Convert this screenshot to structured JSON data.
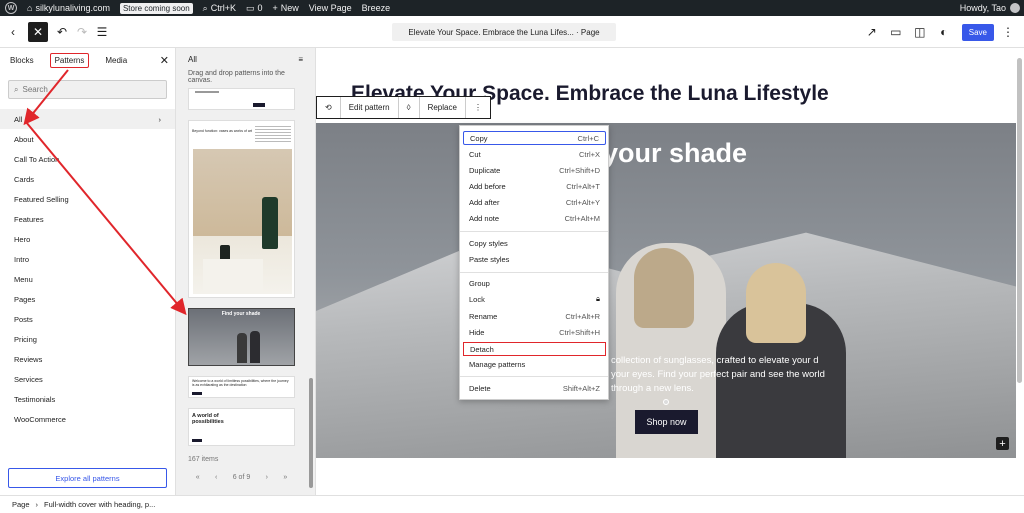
{
  "admin_bar": {
    "site": "silkylunaliving.com",
    "store_badge": "Store coming soon",
    "shortcut": "Ctrl+K",
    "comments_count": "0",
    "new_label": "New",
    "view_page": "View Page",
    "breeze": "Breeze",
    "howdy": "Howdy, Tao"
  },
  "header": {
    "document_title": "Elevate Your Space. Embrace the Luna Lifes... · Page",
    "save_label": "Save"
  },
  "inserter": {
    "tabs": [
      "Blocks",
      "Patterns",
      "Media"
    ],
    "search_placeholder": "Search",
    "categories": [
      "All",
      "About",
      "Call To Action",
      "Cards",
      "Featured Selling",
      "Features",
      "Hero",
      "Intro",
      "Menu",
      "Pages",
      "Posts",
      "Pricing",
      "Reviews",
      "Services",
      "Testimonials",
      "WooCommerce"
    ],
    "explore_label": "Explore all patterns"
  },
  "patterns": {
    "heading": "All",
    "subtitle": "Drag and drop patterns into the canvas.",
    "card2_text": "Beyond function: vases as works of art",
    "card3_text": "Find your shade",
    "card4_text": "Welcome to a world of limitless possibilities, where the journey is as exhilarating as the destination",
    "card5_text": "A world of possibilities",
    "count": "167 items",
    "pager": "6 of 9"
  },
  "canvas": {
    "page_heading": "Elevate Your Space. Embrace the Luna Lifestyle",
    "cover_heading": "d your shade",
    "cover_text": "collection of sunglasses, crafted to elevate your d your eyes. Find your perfect pair and see the world through a new lens.",
    "shop_button": "Shop now"
  },
  "toolbar": {
    "edit_pattern": "Edit pattern",
    "replace": "Replace"
  },
  "context_menu": {
    "items": [
      {
        "label": "Copy",
        "shortcut": "Ctrl+C"
      },
      {
        "label": "Cut",
        "shortcut": "Ctrl+X"
      },
      {
        "label": "Duplicate",
        "shortcut": "Ctrl+Shift+D"
      },
      {
        "label": "Add before",
        "shortcut": "Ctrl+Alt+T"
      },
      {
        "label": "Add after",
        "shortcut": "Ctrl+Alt+Y"
      },
      {
        "label": "Add note",
        "shortcut": "Ctrl+Alt+M"
      },
      {
        "label": "Copy styles",
        "shortcut": ""
      },
      {
        "label": "Paste styles",
        "shortcut": ""
      },
      {
        "label": "Group",
        "shortcut": ""
      },
      {
        "label": "Lock",
        "shortcut": ""
      },
      {
        "label": "Rename",
        "shortcut": "Ctrl+Alt+R"
      },
      {
        "label": "Hide",
        "shortcut": "Ctrl+Shift+H"
      },
      {
        "label": "Detach",
        "shortcut": ""
      },
      {
        "label": "Manage patterns",
        "shortcut": ""
      },
      {
        "label": "Delete",
        "shortcut": "Shift+Alt+Z"
      }
    ]
  },
  "footer": {
    "crumb1": "Page",
    "crumb2": "Full-width cover with heading, p..."
  },
  "colors": {
    "accent": "#3858e9",
    "annotation": "#e0262b",
    "admin_bar": "#1d2327"
  }
}
